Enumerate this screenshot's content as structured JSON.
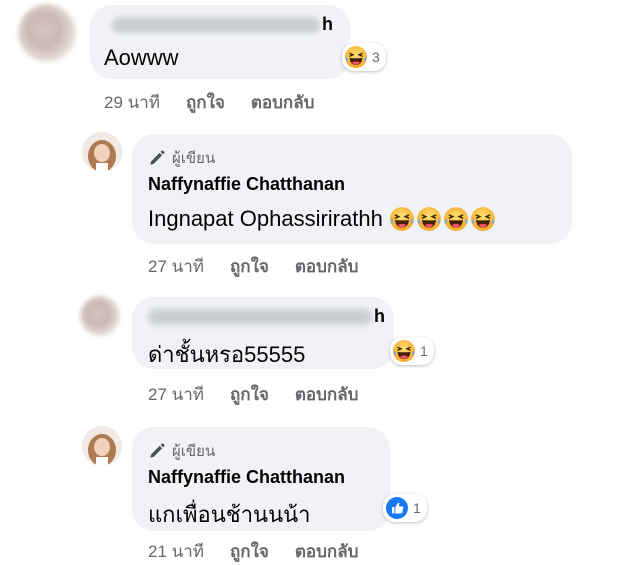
{
  "comments": [
    {
      "text": "Aowww",
      "name_tail": "h",
      "reaction": {
        "emoji": "laugh-icon",
        "count": "3"
      },
      "meta": {
        "time": "29 นาที",
        "like": "ถูกใจ",
        "reply": "ตอบกลับ"
      }
    },
    {
      "badge": "ผู้เขียน",
      "author": "Naffynaffie Chatthanan",
      "text": "Ingnapat Ophassirirathh",
      "emojis": [
        "laugh-icon",
        "laugh-icon",
        "laugh-icon",
        "laugh-icon"
      ],
      "meta": {
        "time": "27 นาที",
        "like": "ถูกใจ",
        "reply": "ตอบกลับ"
      }
    },
    {
      "text": "ด่าชั้นหรอ55555",
      "name_tail": "h",
      "reaction": {
        "emoji": "laugh-icon",
        "count": "1"
      },
      "meta": {
        "time": "27 นาที",
        "like": "ถูกใจ",
        "reply": "ตอบกลับ"
      }
    },
    {
      "badge": "ผู้เขียน",
      "author": "Naffynaffie Chatthanan",
      "text": "แกเพื่อนช้านนน้า",
      "reaction": {
        "emoji": "like-icon",
        "count": "1"
      },
      "meta": {
        "time": "21 นาที",
        "like": "ถูกใจ",
        "reply": "ตอบกลับ"
      }
    }
  ],
  "colors": {
    "bubble": "#f0f2f5",
    "meta": "#65676b",
    "like_blue": "#1877f2",
    "laugh_yellow": "#f7b125"
  }
}
